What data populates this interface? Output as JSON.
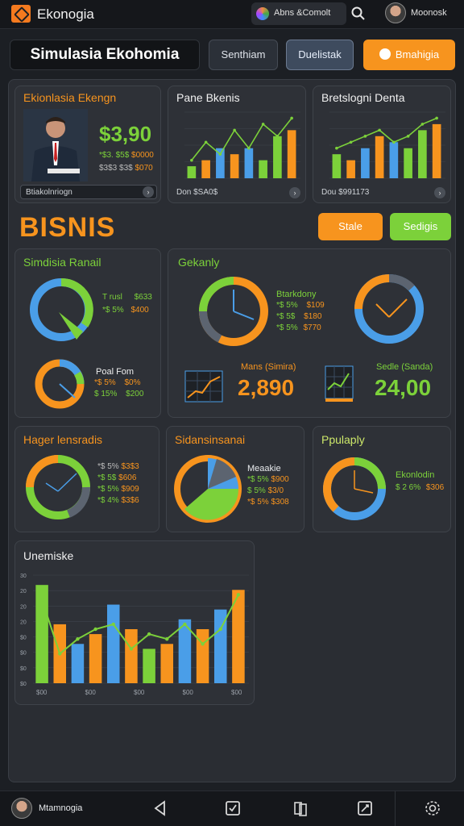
{
  "topbar": {
    "app_title": "Ekonogia",
    "chip_label": "Abns &Comolt",
    "user_name": "Moonosk"
  },
  "header": {
    "title": "Simulasia Ekohomia",
    "btn1": "Senthiam",
    "btn2": "Duelistak",
    "btn3": "Bmahigia"
  },
  "card_presenter": {
    "title": "Ekionlasia Ekengn",
    "big_value": "$3,90",
    "row1": "$0000",
    "row1_prefix": "*$3. $5$",
    "row2": "$070",
    "row2_prefix": "$3$3 $3$",
    "footer": "Btiakolnriogn"
  },
  "card_pane": {
    "title": "Pane Bkenis",
    "footer": "Don $SA0$"
  },
  "card_bretslogni": {
    "title": "Bretslogni Denta",
    "footer": "Dou $991173"
  },
  "section": {
    "title": "BISNIS",
    "btn_stale": "Stale",
    "btn_secc": "Sedigis"
  },
  "card_simdisia": {
    "title": "Simdisia Ranail",
    "rows": [
      {
        "label": "T rusl",
        "value": "$633"
      },
      {
        "label": "*$ 5%",
        "value": "$400"
      }
    ],
    "sub_title": "Poal Fom",
    "sub_rows": [
      {
        "label": "*$ 5%",
        "value": "$0%"
      },
      {
        "label": "$ 15%",
        "value": "$200"
      }
    ]
  },
  "card_gekanly": {
    "title": "Gekanly",
    "legend_title": "Btarkdony",
    "rows": [
      {
        "label": "*$ 5%",
        "value": "$109"
      },
      {
        "label": "*$ 5$",
        "value": "$180"
      },
      {
        "label": "*$ 5%",
        "value": "$770"
      }
    ],
    "metric1_label": "Mans (Simira)",
    "metric1_value": "2,890",
    "metric2_label": "Sedle (Sanda)",
    "metric2_value": "24,00"
  },
  "card_hager": {
    "title": "Hager lensradis",
    "rows": [
      {
        "label": "*$ 5%",
        "value": "$3$3"
      },
      {
        "label": "*$ 5$",
        "value": "$606"
      },
      {
        "label": "*$ 5%",
        "value": "$909"
      },
      {
        "label": "*$ 4%",
        "value": "$3$6"
      }
    ]
  },
  "card_sidans": {
    "title": "Sidansinsanai",
    "legend_title": "Meaakie",
    "rows": [
      {
        "label": "*$ 5%",
        "value": "$900"
      },
      {
        "label": "$ 5%",
        "value": "$3/0"
      },
      {
        "label": "*$ 5%",
        "value": "$308"
      }
    ]
  },
  "card_ppulaply": {
    "title": "Ppulaply",
    "legend_title": "Ekonlodin",
    "row_label": "$ 2 6%",
    "row_value": "$306"
  },
  "card_unemiske": {
    "title": "Unemiske",
    "x_labels": [
      "$00",
      "$00",
      "$00",
      "$00",
      "$00"
    ],
    "y_labels": [
      "30",
      "20",
      "20",
      "20",
      "$0",
      "$0",
      "$0",
      "$0"
    ]
  },
  "nav": {
    "label": "Mtamnogia"
  },
  "chart_data": [
    {
      "type": "bar",
      "title": "Pane Bkenis",
      "series": [
        {
          "values": [
            2,
            3,
            5,
            4,
            5,
            3,
            7,
            8
          ]
        },
        {
          "values": [
            3,
            6,
            4,
            8,
            5,
            9,
            7,
            10
          ]
        }
      ]
    },
    {
      "type": "bar",
      "title": "Bretslogni Denta",
      "series": [
        {
          "values": [
            4,
            3,
            5,
            7,
            6,
            5,
            8,
            9
          ]
        },
        {
          "values": [
            5,
            6,
            7,
            8,
            6,
            7,
            9,
            10
          ]
        }
      ]
    },
    {
      "type": "bar",
      "title": "Unemiske",
      "series": [
        {
          "values": [
            20,
            12,
            8,
            10,
            16,
            11,
            7,
            8,
            13,
            11,
            15,
            19
          ]
        },
        {
          "values": [
            17,
            6,
            9,
            11,
            12,
            7,
            10,
            9,
            12,
            8,
            11,
            18
          ]
        }
      ]
    }
  ],
  "colors": {
    "orange": "#f7941e",
    "green": "#7cd13a",
    "blue": "#4a9ee8",
    "grey": "#5c6470"
  }
}
